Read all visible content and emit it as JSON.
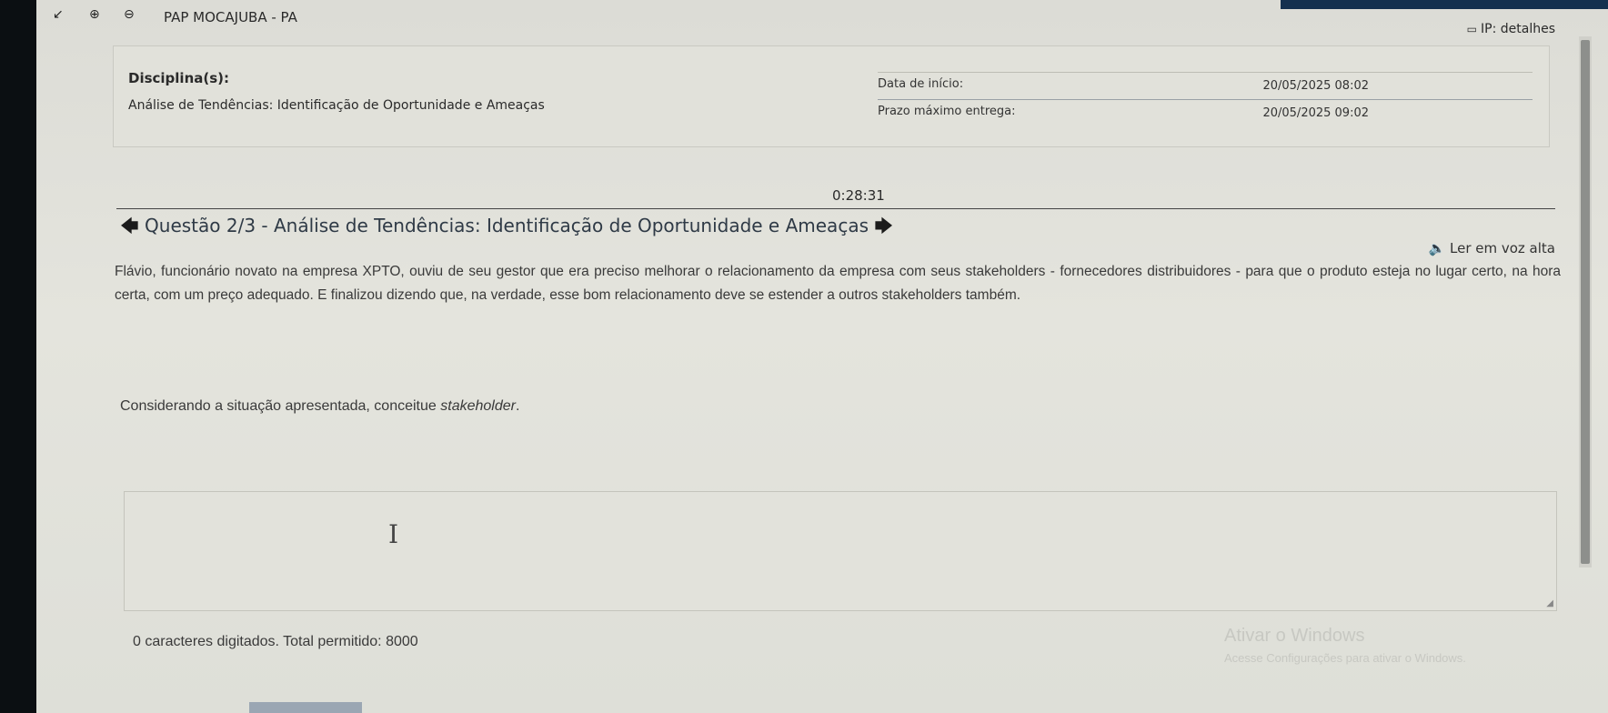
{
  "header": {
    "site_title": "PAP MOCAJUBA - PA",
    "ip_label": "IP: detalhes"
  },
  "info": {
    "disciplina_label": "Disciplina(s):",
    "disciplina_name": "Análise de Tendências: Identificação de Oportunidade e Ameaças",
    "start_label": "Data de início:",
    "start_value": "20/05/2025 08:02",
    "deadline_label": "Prazo máximo entrega:",
    "deadline_value": "20/05/2025 09:02"
  },
  "timer": "0:28:31",
  "question": {
    "title": "Questão 2/3 - Análise de Tendências: Identificação de Oportunidade e Ameaças",
    "prev_icon": "arrow-left-icon",
    "next_icon": "arrow-right-icon",
    "read_aloud": "Ler em voz alta",
    "body": "Flávio, funcionário novato na empresa XPTO, ouviu de seu gestor que era preciso melhorar o relacionamento da empresa com seus stakeholders - fornecedores distribuidores - para que o produto esteja no lugar certo, na hora certa, com um preço adequado. E finalizou dizendo que, na verdade, esse bom relacionamento deve se estender a outros stakeholders também.",
    "prompt_prefix": "Considerando a situação apresentada, conceitue ",
    "prompt_term": "stakeholder",
    "prompt_suffix": "."
  },
  "answer": {
    "value": "",
    "char_count_text": "0 caracteres digitados. Total permitido: 8000"
  },
  "watermark": {
    "line1": "Ativar o Windows",
    "line2": "Acesse Configurações para ativar o Windows."
  }
}
